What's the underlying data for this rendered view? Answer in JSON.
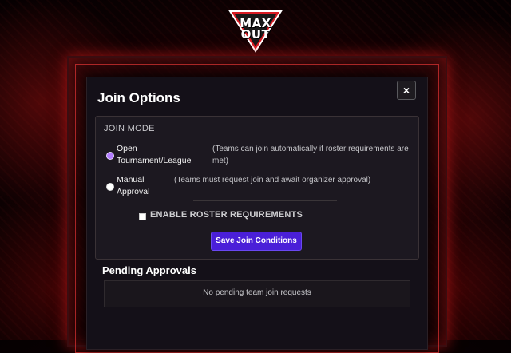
{
  "logo": {
    "line1": "MAX",
    "line2": "OUT"
  },
  "modal": {
    "title": "Join Options",
    "close_label": "×"
  },
  "join_mode": {
    "section_label": "JOIN MODE",
    "options": [
      {
        "label_line1": "Open",
        "label_line2": "Tournament/League",
        "description_line1": "(Teams can join automatically if roster requirements are",
        "description_line2": "met)",
        "selected": true
      },
      {
        "label_line1": "Manual",
        "label_line2": "Approval",
        "description_line1": "(Teams must request join and await organizer approval)",
        "selected": false
      }
    ],
    "roster_checkbox_label": "ENABLE ROSTER REQUIREMENTS",
    "roster_checked": false,
    "save_label": "Save Join Conditions"
  },
  "pending": {
    "title": "Pending Approvals",
    "empty_text": "No pending team join requests"
  },
  "colors": {
    "accent": "#4a1fd8",
    "radio_selected": "#b27cff",
    "glow": "#ff1e1e"
  }
}
